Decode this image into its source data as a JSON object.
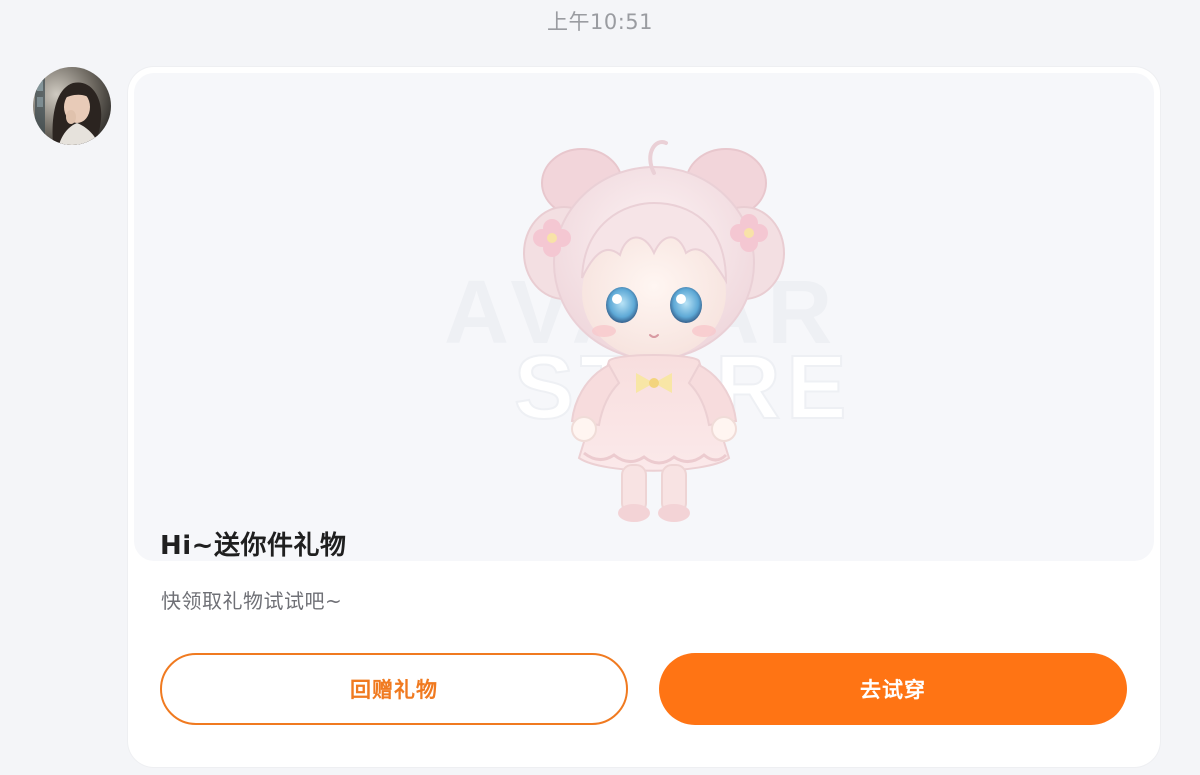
{
  "chat": {
    "timestamp": "上午10:51"
  },
  "sender": {
    "avatar_icon": "user-avatar-photo"
  },
  "gift_card": {
    "image_icon": "chibi-girl-avatar-outfit",
    "watermark_text": "AVATAR STORE",
    "title": "Hi~送你件礼物",
    "subtitle": "快领取礼物试试吧~",
    "return_gift_label": "回赠礼物",
    "try_on_label": "去试穿"
  },
  "colors": {
    "accent": "#ff7414",
    "accent_outline": "#f07a20",
    "background": "#f4f5f8",
    "card": "#ffffff",
    "hero_background": "#f6f7fa"
  }
}
